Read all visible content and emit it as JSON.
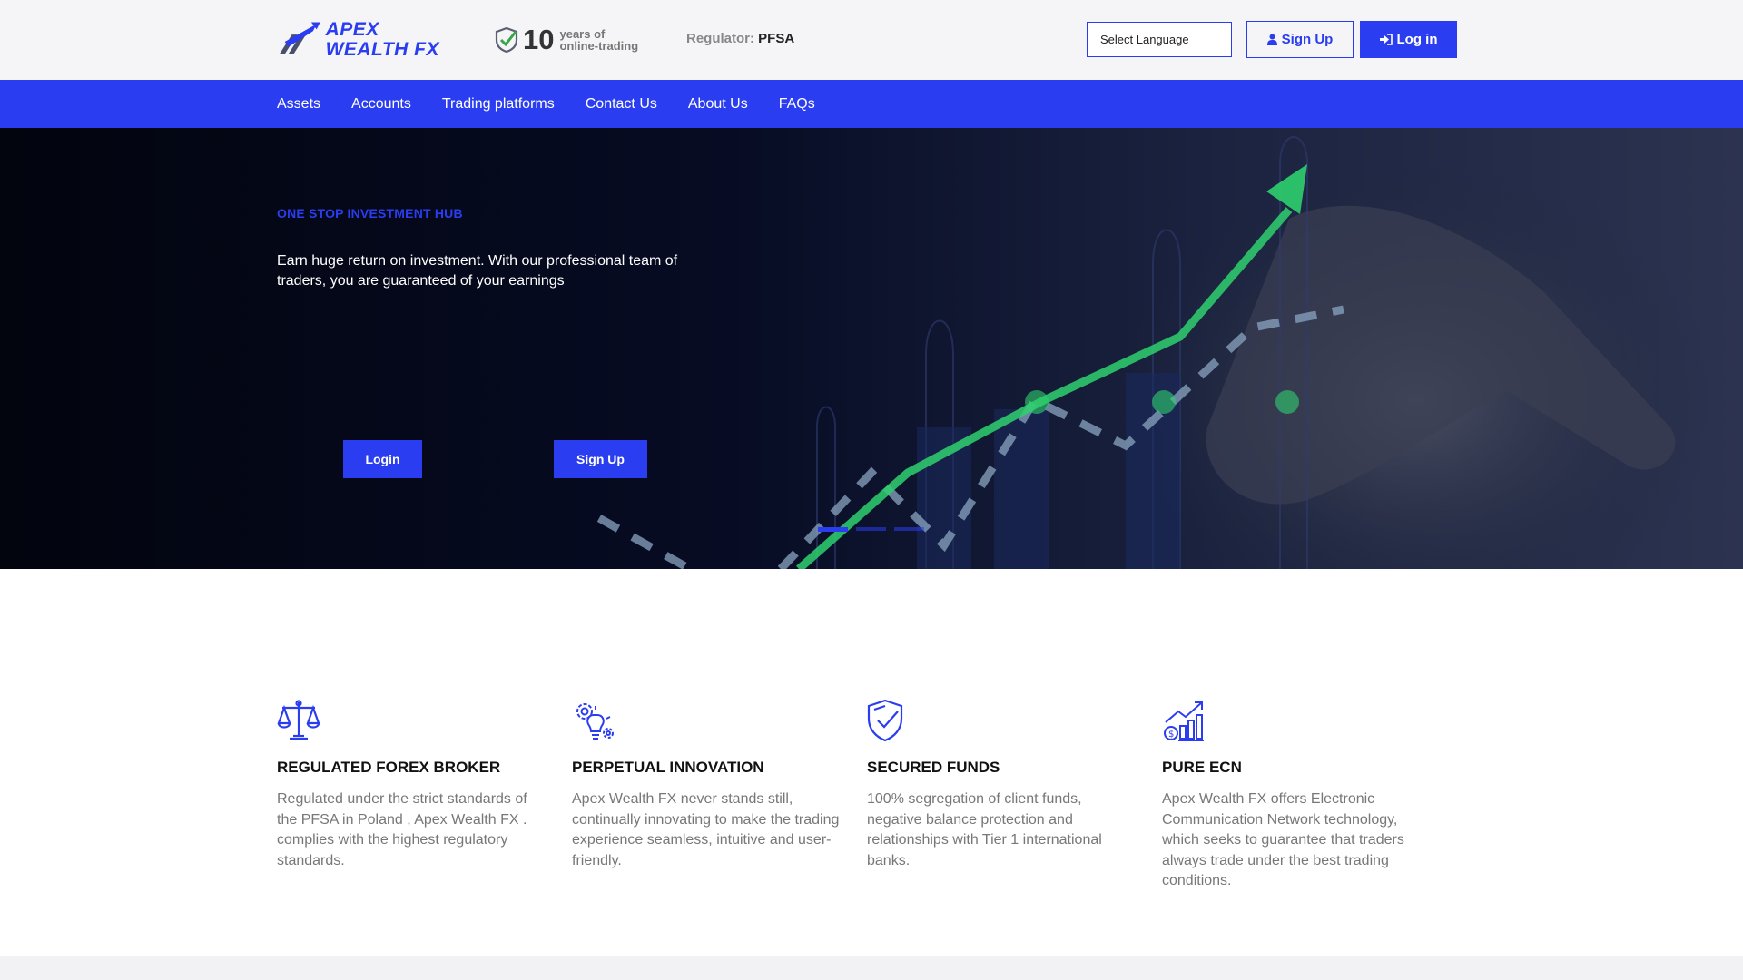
{
  "brand": {
    "line1": "APEX",
    "line2": "WEALTH FX",
    "accent": "#2a3df0"
  },
  "badge": {
    "number": "10",
    "line1": "years of",
    "line2": "online-trading"
  },
  "regulator": {
    "label": "Regulator:",
    "value": "PFSA"
  },
  "header": {
    "language_select": "Select Language",
    "signup_label": "Sign Up",
    "login_label": "Log in"
  },
  "nav": {
    "items": [
      "Assets",
      "Accounts",
      "Trading platforms",
      "Contact Us",
      "About Us",
      "FAQs"
    ]
  },
  "hero": {
    "kicker": "ONE STOP INVESTMENT HUB",
    "text": "Earn huge return on investment. With our professional team of traders, you are guaranteed of your earnings",
    "login_label": "Login",
    "signup_label": "Sign Up",
    "slides": 3,
    "active_slide": 1
  },
  "features": [
    {
      "icon": "scales-icon",
      "title": "REGULATED FOREX BROKER",
      "desc": "Regulated under the strict standards of the PFSA in Poland , Apex Wealth FX . complies with the highest regulatory standards."
    },
    {
      "icon": "innovation-icon",
      "title": "PERPETUAL INNOVATION",
      "desc": "Apex Wealth FX never stands still, continually innovating to make the trading experience seamless, intuitive and user-friendly."
    },
    {
      "icon": "shield-check-icon",
      "title": "SECURED FUNDS",
      "desc": "100% segregation of client funds, negative balance protection and relationships with Tier 1 international banks."
    },
    {
      "icon": "growth-chart-icon",
      "title": "PURE ECN",
      "desc": "Apex Wealth FX offers Electronic Communication Network technology, which seeks to guarantee that traders always trade under the best trading conditions."
    }
  ]
}
